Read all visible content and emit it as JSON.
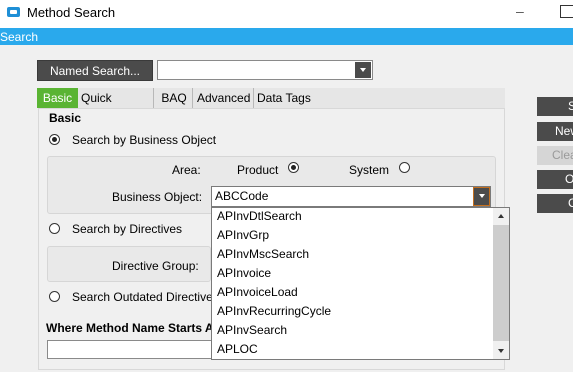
{
  "window": {
    "title": "Method Search"
  },
  "menu": {
    "search": "Search"
  },
  "named_search": {
    "button_label": "Named Search...",
    "value": ""
  },
  "tabs": [
    {
      "label": "Basic",
      "active": true
    },
    {
      "label": "Quick Search"
    },
    {
      "label": "BAQ"
    },
    {
      "label": "Advanced"
    },
    {
      "label": "Data Tags"
    }
  ],
  "basic": {
    "heading": "Basic",
    "search_by_business_object": {
      "label": "Search by Business Object",
      "selected": true
    },
    "area": {
      "label": "Area:",
      "options": [
        {
          "label": "Product",
          "selected": true
        },
        {
          "label": "System",
          "selected": false
        }
      ]
    },
    "business_object": {
      "label": "Business Object:",
      "value": "ABCCode"
    },
    "search_by_directives": {
      "label": "Search by Directives",
      "selected": false
    },
    "directive_group": {
      "label": "Directive Group:"
    },
    "search_outdated": {
      "label": "Search Outdated Directive",
      "selected": false
    },
    "where_method": {
      "label": "Where Method Name Starts A",
      "value": ""
    }
  },
  "dropdown_options": [
    "APInvDtlSearch",
    "APInvGrp",
    "APInvMscSearch",
    "APInvoice",
    "APInvoiceLoad",
    "APInvRecurringCycle",
    "APInvSearch",
    "APLOC"
  ],
  "right_buttons": [
    {
      "label": "S",
      "enabled": true
    },
    {
      "label": "New",
      "enabled": true
    },
    {
      "label": "Clea",
      "enabled": false
    },
    {
      "label": "O",
      "enabled": true
    },
    {
      "label": "C",
      "enabled": true
    }
  ],
  "colors": {
    "accent_blue": "#2aa9ec",
    "tab_active_green": "#5ab433",
    "button_dark": "#4b4b4b"
  }
}
